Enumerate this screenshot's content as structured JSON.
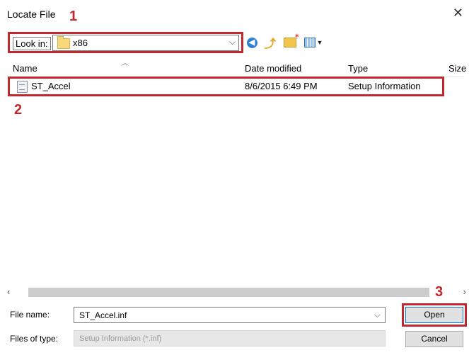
{
  "window": {
    "title": "Locate File"
  },
  "annotations": [
    "1",
    "2",
    "3"
  ],
  "look_in": {
    "label": "Look in:",
    "value": "x86"
  },
  "columns": {
    "name": "Name",
    "date": "Date modified",
    "type": "Type",
    "size": "Size"
  },
  "files": [
    {
      "name": "ST_Accel",
      "date": "8/6/2015 6:49 PM",
      "type": "Setup Information"
    }
  ],
  "file_name": {
    "label": "File name:",
    "value": "ST_Accel.inf"
  },
  "files_of_type": {
    "label": "Files of type:",
    "value": "Setup Information (*.inf)"
  },
  "buttons": {
    "open": "Open",
    "cancel": "Cancel"
  },
  "colors": {
    "annotation": "#c0282d",
    "accent": "#0078d7"
  },
  "icons": [
    "close-icon",
    "folder-icon",
    "back-icon",
    "up-folder-icon",
    "new-folder-icon",
    "view-menu-icon",
    "file-icon",
    "scroll-left-icon",
    "scroll-right-icon",
    "chevron-down-icon"
  ]
}
